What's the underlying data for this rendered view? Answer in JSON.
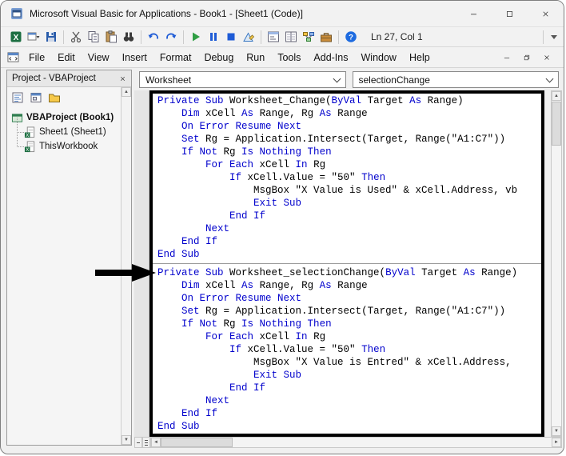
{
  "window": {
    "title": "Microsoft Visual Basic for Applications - Book1 - [Sheet1 (Code)]",
    "caption_buttons": [
      "minimize-icon",
      "maximize-icon",
      "close-icon"
    ]
  },
  "toolbar": {
    "status": "Ln 27, Col 1",
    "items": [
      "view-microsoft-excel-icon",
      "insert-userform-icon",
      "save-icon",
      "separator",
      "cut-icon",
      "copy-icon",
      "paste-icon",
      "find-icon",
      "separator",
      "undo-icon",
      "redo-icon",
      "separator",
      "run-icon",
      "break-icon",
      "reset-icon",
      "design-mode-icon",
      "separator",
      "project-explorer-icon",
      "properties-window-icon",
      "object-browser-icon",
      "toolbox-icon",
      "separator",
      "help-icon"
    ]
  },
  "menubar": {
    "items": [
      "File",
      "Edit",
      "View",
      "Insert",
      "Format",
      "Debug",
      "Run",
      "Tools",
      "Add-Ins",
      "Window",
      "Help"
    ],
    "child_window_controls": [
      "minimize-icon",
      "restore-icon",
      "close-icon"
    ]
  },
  "project_panel": {
    "title": "Project - VBAProject",
    "toolbar_icons": [
      "view-code-icon",
      "view-object-icon",
      "toggle-folders-icon"
    ],
    "tree": [
      {
        "label": "VBAProject (Book1)",
        "icon": "vbaproject-icon",
        "level": 0,
        "bold": true
      },
      {
        "label": "Sheet1 (Sheet1)",
        "icon": "sheet-icon",
        "level": 1,
        "bold": false
      },
      {
        "label": "ThisWorkbook",
        "icon": "workbook-icon",
        "level": 1,
        "bold": false
      }
    ]
  },
  "code_pane": {
    "object_dropdown": "Worksheet",
    "procedure_dropdown": "selectionChange",
    "separator_after_line": 13,
    "lines": [
      [
        [
          "k",
          "Private Sub "
        ],
        [
          "n",
          "Worksheet_Change("
        ],
        [
          "k",
          "ByVal"
        ],
        [
          "n",
          " Target "
        ],
        [
          "k",
          "As"
        ],
        [
          "n",
          " Range)"
        ]
      ],
      [
        [
          "n",
          "    "
        ],
        [
          "k",
          "Dim"
        ],
        [
          "n",
          " xCell "
        ],
        [
          "k",
          "As"
        ],
        [
          "n",
          " Range, Rg "
        ],
        [
          "k",
          "As"
        ],
        [
          "n",
          " Range"
        ]
      ],
      [
        [
          "n",
          "    "
        ],
        [
          "k",
          "On Error Resume Next"
        ]
      ],
      [
        [
          "n",
          "    "
        ],
        [
          "k",
          "Set"
        ],
        [
          "n",
          " Rg = Application.Intersect(Target, Range(\"A1:C7\"))"
        ]
      ],
      [
        [
          "n",
          "    "
        ],
        [
          "k",
          "If Not"
        ],
        [
          "n",
          " Rg "
        ],
        [
          "k",
          "Is Nothing Then"
        ]
      ],
      [
        [
          "n",
          "        "
        ],
        [
          "k",
          "For Each"
        ],
        [
          "n",
          " xCell "
        ],
        [
          "k",
          "In"
        ],
        [
          "n",
          " Rg"
        ]
      ],
      [
        [
          "n",
          "            "
        ],
        [
          "k",
          "If"
        ],
        [
          "n",
          " xCell.Value = \"50\" "
        ],
        [
          "k",
          "Then"
        ]
      ],
      [
        [
          "n",
          "                MsgBox \"X Value is Used\" & xCell.Address, vb"
        ]
      ],
      [
        [
          "n",
          "                "
        ],
        [
          "k",
          "Exit Sub"
        ]
      ],
      [
        [
          "n",
          "            "
        ],
        [
          "k",
          "End If"
        ]
      ],
      [
        [
          "n",
          "        "
        ],
        [
          "k",
          "Next"
        ]
      ],
      [
        [
          "n",
          "    "
        ],
        [
          "k",
          "End If"
        ]
      ],
      [
        [
          "k",
          "End Sub"
        ]
      ],
      [
        [
          "k",
          "Private Sub "
        ],
        [
          "n",
          "Worksheet_selectionChange("
        ],
        [
          "k",
          "ByVal"
        ],
        [
          "n",
          " Target "
        ],
        [
          "k",
          "As"
        ],
        [
          "n",
          " Range)"
        ]
      ],
      [
        [
          "n",
          "    "
        ],
        [
          "k",
          "Dim"
        ],
        [
          "n",
          " xCell "
        ],
        [
          "k",
          "As"
        ],
        [
          "n",
          " Range, Rg "
        ],
        [
          "k",
          "As"
        ],
        [
          "n",
          " Range"
        ]
      ],
      [
        [
          "n",
          "    "
        ],
        [
          "k",
          "On Error Resume Next"
        ]
      ],
      [
        [
          "n",
          "    "
        ],
        [
          "k",
          "Set"
        ],
        [
          "n",
          " Rg = Application.Intersect(Target, Range(\"A1:C7\"))"
        ]
      ],
      [
        [
          "n",
          "    "
        ],
        [
          "k",
          "If Not"
        ],
        [
          "n",
          " Rg "
        ],
        [
          "k",
          "Is Nothing Then"
        ]
      ],
      [
        [
          "n",
          "        "
        ],
        [
          "k",
          "For Each"
        ],
        [
          "n",
          " xCell "
        ],
        [
          "k",
          "In"
        ],
        [
          "n",
          " Rg"
        ]
      ],
      [
        [
          "n",
          "            "
        ],
        [
          "k",
          "If"
        ],
        [
          "n",
          " xCell.Value = \"50\" "
        ],
        [
          "k",
          "Then"
        ]
      ],
      [
        [
          "n",
          "                MsgBox \"X Value is Entred\" & xCell.Address,"
        ]
      ],
      [
        [
          "n",
          "                "
        ],
        [
          "k",
          "Exit Sub"
        ]
      ],
      [
        [
          "n",
          "            "
        ],
        [
          "k",
          "End If"
        ]
      ],
      [
        [
          "n",
          "        "
        ],
        [
          "k",
          "Next"
        ]
      ],
      [
        [
          "n",
          "    "
        ],
        [
          "k",
          "End If"
        ]
      ],
      [
        [
          "k",
          "End Sub"
        ]
      ]
    ]
  },
  "colors": {
    "keyword_blue": "#0000cc",
    "annotation_arrow": "#000000"
  }
}
